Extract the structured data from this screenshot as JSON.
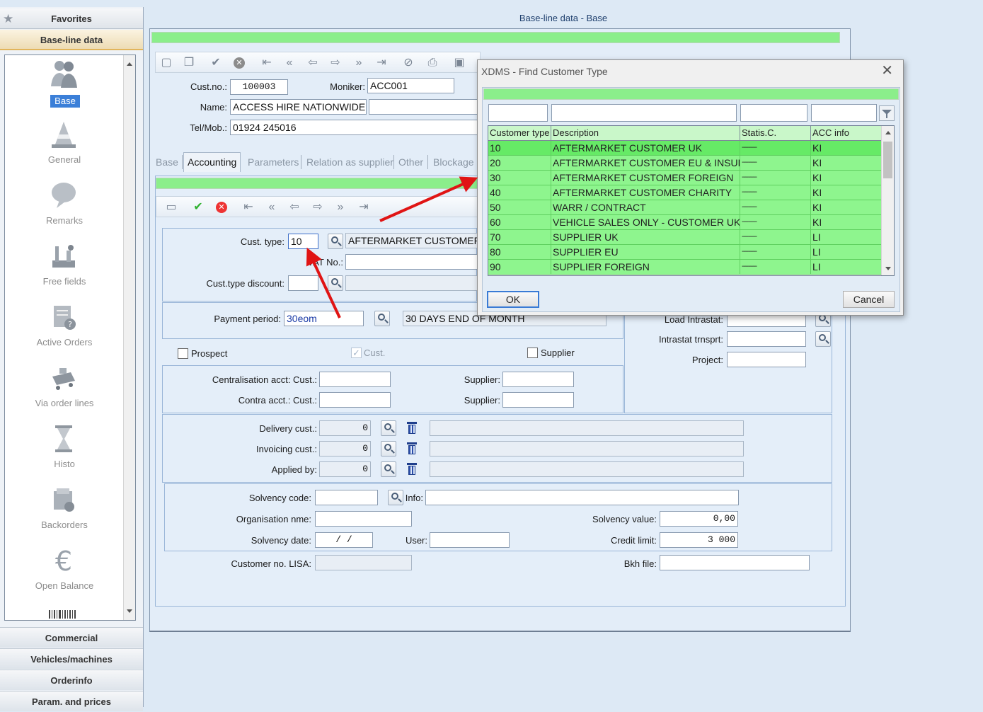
{
  "main_title": "Base-line data - Base",
  "nav": {
    "favorites": "Favorites",
    "active_section": "Base-line data",
    "items": [
      {
        "label": "Base",
        "icon": "users-icon"
      },
      {
        "label": "General",
        "icon": "traffic-cone-icon"
      },
      {
        "label": "Remarks",
        "icon": "speech-bubble-icon"
      },
      {
        "label": "Free fields",
        "icon": "tools-icon"
      },
      {
        "label": "Active Orders",
        "icon": "orders-icon"
      },
      {
        "label": "Via order lines",
        "icon": "cart-icon"
      },
      {
        "label": "Histo",
        "icon": "hourglass-icon"
      },
      {
        "label": "Backorders",
        "icon": "backorders-icon"
      },
      {
        "label": "Open Balance",
        "icon": "euro-icon"
      }
    ],
    "sections": [
      "Commercial",
      "Vehicles/machines",
      "Orderinfo",
      "Param. and prices"
    ]
  },
  "header": {
    "cust_no_label": "Cust.no.:",
    "cust_no": "100003",
    "moniker_label": "Moniker:",
    "moniker": "ACC001",
    "name_label": "Name:",
    "name": "ACCESS HIRE NATIONWIDE I",
    "tel_label": "Tel/Mob.:",
    "tel": "01924 245016"
  },
  "tabs": [
    "Base",
    "Accounting",
    "Parameters",
    "Relation as supplier",
    "Other",
    "Blockage"
  ],
  "accounting": {
    "cust_type_label": "Cust. type:",
    "cust_type": "10",
    "cust_type_desc": "AFTERMARKET CUSTOMER",
    "vat_label": "VAT No.:",
    "cust_type_discount_label": "Cust.type discount:",
    "payment_period_label": "Payment period:",
    "payment_period": "30eom",
    "payment_period_desc": "30 DAYS END OF MONTH",
    "load_intrastat_label": "Load Intrastat:",
    "intrastat_trnsprt_label": "Intrastat trnsprt:",
    "project_label": "Project:",
    "prospect_label": "Prospect",
    "cust_label": "Cust.",
    "supplier_label": "Supplier",
    "centralisation_label": "Centralisation acct: Cust.:",
    "contra_label": "Contra acct.: Cust.:",
    "supplier_field_label": "Supplier:",
    "delivery_cust_label": "Delivery cust.:",
    "delivery_cust": "0",
    "invoicing_cust_label": "Invoicing cust.:",
    "invoicing_cust": "0",
    "applied_by_label": "Applied by:",
    "applied_by": "0",
    "solvency_code_label": "Solvency code:",
    "info_label": "Info:",
    "organisation_label": "Organisation nme:",
    "solvency_value_label": "Solvency value:",
    "solvency_value": "0,00",
    "solvency_date_label": "Solvency date:",
    "solvency_date": "/ /",
    "user_label": "User:",
    "credit_limit_label": "Credit limit:",
    "credit_limit": "3 000",
    "lisa_label": "Customer no. LISA:",
    "bkh_label": "Bkh file:"
  },
  "dialog": {
    "title": "XDMS  -  Find Customer Type",
    "columns": [
      "Customer type",
      "Description",
      "Statis.C.",
      "ACC info"
    ],
    "rows": [
      {
        "code": "10",
        "desc": "AFTERMARKET CUSTOMER UK",
        "stat": "---------",
        "acc": "KI"
      },
      {
        "code": "20",
        "desc": "AFTERMARKET CUSTOMER EU & INSURA",
        "stat": "---------",
        "acc": "KI"
      },
      {
        "code": "30",
        "desc": "AFTERMARKET CUSTOMER FOREIGN",
        "stat": "---------",
        "acc": "KI"
      },
      {
        "code": "40",
        "desc": "AFTERMARKET CUSTOMER CHARITY",
        "stat": "---------",
        "acc": "KI"
      },
      {
        "code": "50",
        "desc": "WARR / CONTRACT",
        "stat": "---------",
        "acc": "KI"
      },
      {
        "code": "60",
        "desc": "VEHICLE SALES ONLY - CUSTOMER UK",
        "stat": "---------",
        "acc": "KI"
      },
      {
        "code": "70",
        "desc": "SUPPLIER UK",
        "stat": "---------",
        "acc": "LI"
      },
      {
        "code": "80",
        "desc": "SUPPLIER EU",
        "stat": "---------",
        "acc": "LI"
      },
      {
        "code": "90",
        "desc": "SUPPLIER FOREIGN",
        "stat": "---------",
        "acc": "LI"
      }
    ],
    "ok": "OK",
    "cancel": "Cancel"
  },
  "colors": {
    "grid_green": "#8ef58e",
    "bar_green": "#8bee8b",
    "annotation_red": "#e01414",
    "selection_blue": "#3b7fd8"
  }
}
